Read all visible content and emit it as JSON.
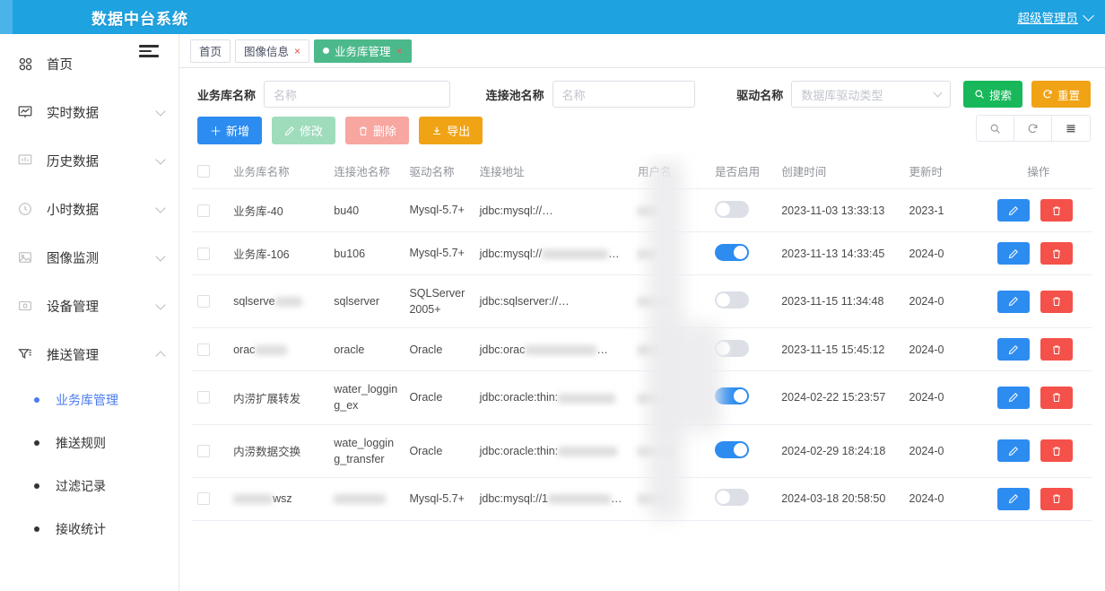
{
  "header": {
    "title": "数据中台系统",
    "user": "超级管理员",
    "user_chevron_icon": "chevron-down-icon"
  },
  "sidebar": {
    "items": [
      {
        "label": "首页",
        "icon": "grid-icon",
        "expandable": false,
        "expanded": false
      },
      {
        "label": "实时数据",
        "icon": "monitor-chart-icon",
        "expandable": true,
        "expanded": false
      },
      {
        "label": "历史数据",
        "icon": "presentation-chart-icon",
        "expandable": true,
        "expanded": false
      },
      {
        "label": "小时数据",
        "icon": "clock-icon",
        "expandable": true,
        "expanded": false
      },
      {
        "label": "图像监测",
        "icon": "image-icon",
        "expandable": true,
        "expanded": false
      },
      {
        "label": "设备管理",
        "icon": "device-icon",
        "expandable": true,
        "expanded": false
      },
      {
        "label": "推送管理",
        "icon": "funnel-icon",
        "expandable": true,
        "expanded": true
      }
    ],
    "submenu": [
      {
        "label": "业务库管理",
        "active": true
      },
      {
        "label": "推送规则",
        "active": false
      },
      {
        "label": "过滤记录",
        "active": false
      },
      {
        "label": "接收统计",
        "active": false
      }
    ]
  },
  "tabs": {
    "collapse_icon": "hamburger-collapse-icon",
    "items": [
      {
        "label": "首页",
        "closable": false,
        "active": false
      },
      {
        "label": "图像信息",
        "closable": true,
        "active": false
      },
      {
        "label": "业务库管理",
        "closable": true,
        "active": true
      }
    ],
    "close_glyph": "×"
  },
  "filters": {
    "db_name_label": "业务库名称",
    "db_name_placeholder": "名称",
    "db_name_value": "",
    "pool_name_label": "连接池名称",
    "pool_name_placeholder": "名称",
    "pool_name_value": "",
    "driver_label": "驱动名称",
    "driver_placeholder": "数据库驱动类型",
    "driver_value": "",
    "search_button": "搜索",
    "search_icon": "search-icon",
    "reset_button": "重置",
    "reset_icon": "refresh-icon"
  },
  "toolbar": {
    "add_label": "新增",
    "add_icon": "plus-icon",
    "edit_label": "修改",
    "edit_icon": "pencil-icon",
    "delete_label": "删除",
    "delete_icon": "trash-icon",
    "export_label": "导出",
    "export_icon": "download-icon",
    "tools": [
      {
        "icon": "search-icon",
        "name": "table-search-tool"
      },
      {
        "icon": "refresh-icon",
        "name": "table-refresh-tool"
      },
      {
        "icon": "columns-icon",
        "name": "table-columns-tool"
      }
    ]
  },
  "table": {
    "columns": [
      "业务库名称",
      "连接池名称",
      "驱动名称",
      "连接地址",
      "用户名",
      "是否启用",
      "创建时间",
      "更新时",
      "操作"
    ],
    "rows": [
      {
        "name": "业务库-40",
        "pool": "bu40",
        "driver": "Mysql-5.7+",
        "address": "jdbc:mysql://",
        "address_redacted": true,
        "user": "",
        "user_redacted": true,
        "enabled": false,
        "created": "2023-11-03 13:33:13",
        "updated": "2023-1",
        "edit_icon": "pencil-icon",
        "delete_icon": "trash-icon"
      },
      {
        "name": "业务库-106",
        "pool": "bu106",
        "driver": "Mysql-5.7+",
        "address": "jdbc:mysql://",
        "address_redacted": true,
        "user": "",
        "user_redacted": true,
        "enabled": true,
        "created": "2023-11-13 14:33:45",
        "updated": "2024-0",
        "edit_icon": "pencil-icon",
        "delete_icon": "trash-icon"
      },
      {
        "name": "sqlserve",
        "name_redacted": true,
        "pool": "sqlserver",
        "driver": "SQLServer 2005+",
        "address": "jdbc:sqlserver://",
        "address_redacted": true,
        "user": "",
        "user_redacted": true,
        "enabled": false,
        "created": "2023-11-15 11:34:48",
        "updated": "2024-0",
        "edit_icon": "pencil-icon",
        "delete_icon": "trash-icon"
      },
      {
        "name": "orac",
        "name_redacted": true,
        "pool": "oracle",
        "driver": "Oracle",
        "address": "jdbc:orac",
        "address_redacted": true,
        "user": "",
        "user_redacted": true,
        "enabled": false,
        "created": "2023-11-15 15:45:12",
        "updated": "2024-0",
        "edit_icon": "pencil-icon",
        "delete_icon": "trash-icon"
      },
      {
        "name": "内涝扩展转发",
        "pool": "water_logging_ex",
        "driver": "Oracle",
        "address": "jdbc:oracle:thin:",
        "address_redacted": true,
        "user": "",
        "user_redacted": true,
        "enabled": true,
        "created": "2024-02-22 15:23:57",
        "updated": "2024-0",
        "edit_icon": "pencil-icon",
        "delete_icon": "trash-icon"
      },
      {
        "name": "内涝数据交换",
        "pool": "wate_logging_transfer",
        "driver": "Oracle",
        "address": "jdbc:oracle:thin:",
        "address_redacted": true,
        "user": "",
        "user_redacted": true,
        "enabled": true,
        "created": "2024-02-29 18:24:18",
        "updated": "2024-0",
        "edit_icon": "pencil-icon",
        "delete_icon": "trash-icon"
      },
      {
        "name": "wsz",
        "name_redacted": true,
        "pool": "",
        "pool_redacted": true,
        "driver": "Mysql-5.7+",
        "address": "jdbc:mysql://1",
        "address_redacted": true,
        "user": "",
        "user_redacted": true,
        "enabled": false,
        "created": "2024-03-18 20:58:50",
        "updated": "2024-0",
        "edit_icon": "pencil-icon",
        "delete_icon": "trash-icon"
      }
    ]
  },
  "colors": {
    "header_blue": "#1EA2E0",
    "accent_blue": "#2d8cf0",
    "active_tab_green": "#4CB98B",
    "search_green": "#18B85A",
    "reset_orange": "#F0A315",
    "delete_red": "#f4514a",
    "active_menu_blue": "#4A7BEF"
  }
}
